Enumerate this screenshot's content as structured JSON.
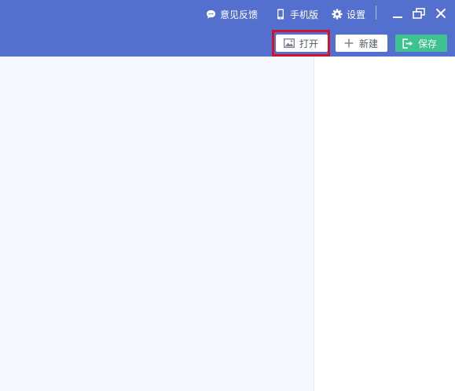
{
  "topbar": {
    "feedback_label": "意见反馈",
    "mobile_label": "手机版",
    "settings_label": "设置",
    "background_color": "#5470cf"
  },
  "toolbar": {
    "open_label": "打开",
    "new_label": "新建",
    "save_label": "保存",
    "save_color": "#3ec28f"
  },
  "icons": [
    "chat-bubble-icon",
    "phone-icon",
    "gear-icon",
    "minimize-icon",
    "restore-icon",
    "close-icon",
    "image-icon",
    "plus-icon",
    "exit-icon"
  ],
  "annotation": {
    "highlight_color": "#d0142c",
    "highlight_target": "open-button"
  }
}
